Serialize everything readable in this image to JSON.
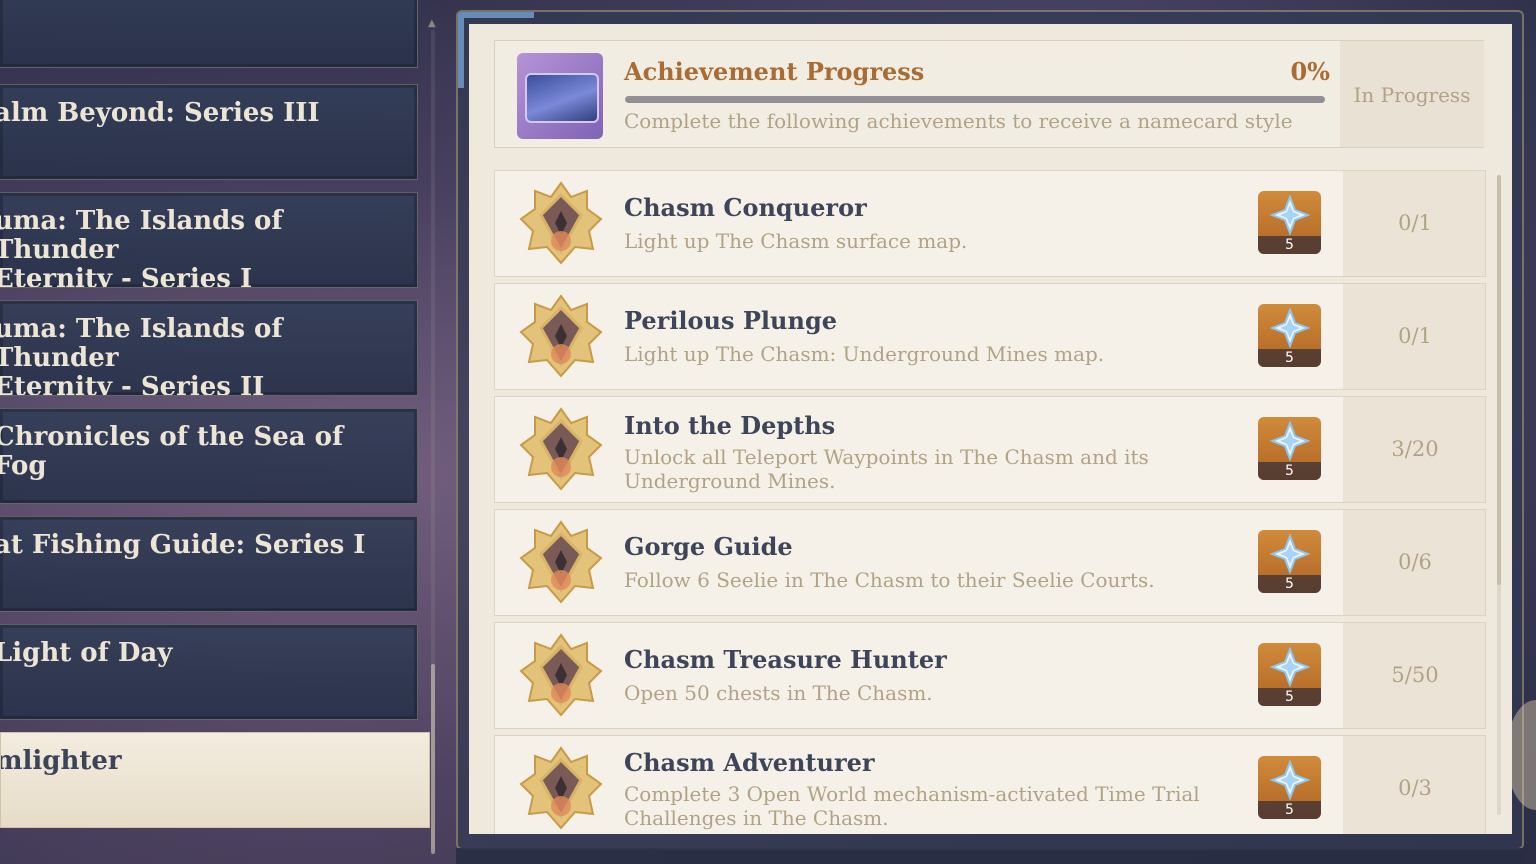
{
  "left_list": {
    "items": [
      {
        "label": "",
        "selected": false
      },
      {
        "label": "alm Beyond: Series III",
        "selected": false
      },
      {
        "label": "uma: The Islands of Thunder\nEternity - Series I",
        "selected": false
      },
      {
        "label": "uma: The Islands of Thunder\nEternity - Series II",
        "selected": false
      },
      {
        "label": "Chronicles of the Sea of Fog",
        "selected": false
      },
      {
        "label": "at Fishing Guide: Series I",
        "selected": false
      },
      {
        "label": "Light of Day",
        "selected": false
      },
      {
        "label": "mlighter",
        "selected": true
      }
    ]
  },
  "progress": {
    "title": "Achievement Progress",
    "percent_label": "0%",
    "percent": 0,
    "description": "Complete the following achievements to receive a namecard style",
    "status": "In Progress"
  },
  "achievements": [
    {
      "title": "Chasm Conqueror",
      "description": "Light up The Chasm surface map.",
      "reward_qty": "5",
      "count": "0/1",
      "badge_icon": "achievement-badge-icon",
      "reward_icon": "primogem-icon"
    },
    {
      "title": "Perilous Plunge",
      "description": "Light up The Chasm: Underground Mines map.",
      "reward_qty": "5",
      "count": "0/1",
      "badge_icon": "achievement-badge-icon",
      "reward_icon": "primogem-icon"
    },
    {
      "title": "Into the Depths",
      "description": "Unlock all Teleport Waypoints in The Chasm and its Underground Mines.",
      "reward_qty": "5",
      "count": "3/20",
      "badge_icon": "achievement-badge-icon",
      "reward_icon": "primogem-icon"
    },
    {
      "title": "Gorge Guide",
      "description": "Follow 6 Seelie in The Chasm to their Seelie Courts.",
      "reward_qty": "5",
      "count": "0/6",
      "badge_icon": "achievement-badge-icon",
      "reward_icon": "primogem-icon"
    },
    {
      "title": "Chasm Treasure Hunter",
      "description": "Open 50 chests in The Chasm.",
      "reward_qty": "5",
      "count": "5/50",
      "badge_icon": "achievement-badge-icon",
      "reward_icon": "primogem-icon"
    },
    {
      "title": "Chasm Adventurer",
      "description": "Complete 3 Open World mechanism-activated Time Trial Challenges in The Chasm.",
      "reward_qty": "5",
      "count": "0/3",
      "badge_icon": "achievement-badge-icon",
      "reward_icon": "primogem-icon"
    }
  ],
  "colors": {
    "accent_gold": "#a86c34",
    "title_text": "#3f4558",
    "muted_text": "#b2a285",
    "reward_bg": "#c07832",
    "category_bg": "#323c58"
  }
}
